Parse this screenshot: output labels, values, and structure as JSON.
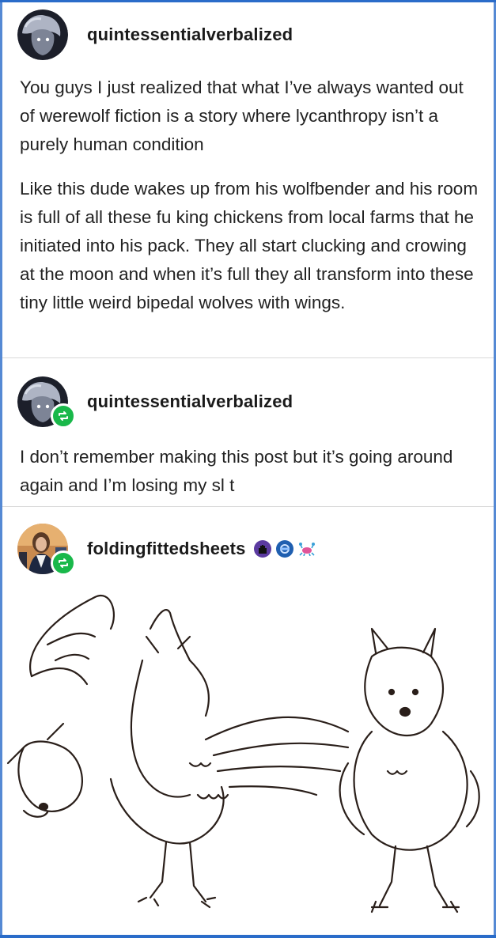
{
  "colors": {
    "accent_blue": "#2a6cc9",
    "reblog_green": "#19b84a",
    "text": "#222222",
    "divider": "#d9d9d9"
  },
  "post1": {
    "username": "quintessentialverbalized",
    "avatar": "grey-haired-character-avatar",
    "paragraphs": [
      "You guys I just realized that what I’ve always wanted out of werewolf fiction is a story where lycanthropy isn’t a purely human condition",
      "Like this dude wakes up from his wolfbender and his room is full of all these fu  king chickens from local farms that he initiated into his pack. They all start clucking and crowing at the moon and when it’s full they all transform into these tiny little weird bipedal wolves with wings."
    ]
  },
  "post2": {
    "username": "quintessentialverbalized",
    "avatar": "grey-haired-character-avatar",
    "reblog_icon": "reblog-icon",
    "text": "I don’t remember making this post but it’s going around again and I’m losing my sl  t"
  },
  "post3": {
    "username": "foldingfittedsheets",
    "avatar": "person-photo-avatar",
    "reblog_icon": "reblog-icon",
    "badges": [
      "purple-hand-badge",
      "blue-gear-badge",
      "crab-badge"
    ],
    "image": "sketch of chicken-wolf hybrid creatures"
  }
}
